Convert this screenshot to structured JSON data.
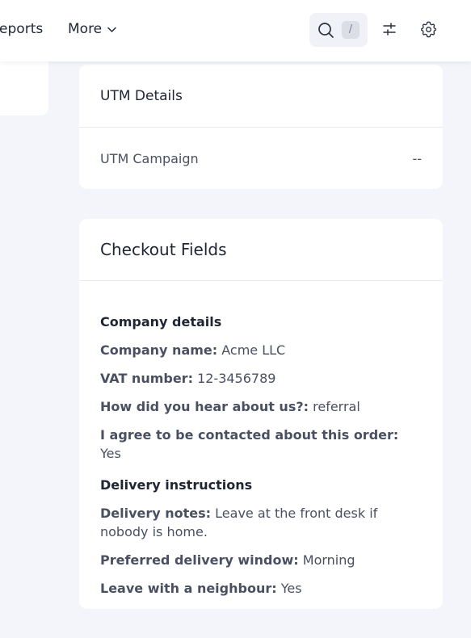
{
  "nav": {
    "reports_label": "Reports",
    "more_label": "More"
  },
  "search": {
    "shortcut": "/"
  },
  "utm_card": {
    "title": "UTM Details",
    "rows": [
      {
        "label": "UTM Campaign",
        "value": "--"
      }
    ]
  },
  "checkout_card": {
    "title": "Checkout Fields",
    "groups": [
      {
        "title": "Company details",
        "fields": [
          {
            "label": "Company name:",
            "value": "Acme LLC"
          },
          {
            "label": "VAT number:",
            "value": "12-3456789"
          },
          {
            "label": "How did you hear about us?:",
            "value": "referral"
          },
          {
            "label": "I agree to be contacted about this order:",
            "value": "Yes"
          }
        ]
      },
      {
        "title": "Delivery instructions",
        "fields": [
          {
            "label": "Delivery notes:",
            "value": "Leave at the front desk if nobody is home."
          },
          {
            "label": "Preferred delivery window:",
            "value": "Morning"
          },
          {
            "label": "Leave with a neighbour:",
            "value": "Yes"
          }
        ]
      }
    ]
  },
  "colors": {
    "background": "#f4f5fb",
    "card": "#ffffff",
    "text_primary": "#1f2533",
    "text_secondary": "#4a5061",
    "divider": "#e8e9ef"
  }
}
